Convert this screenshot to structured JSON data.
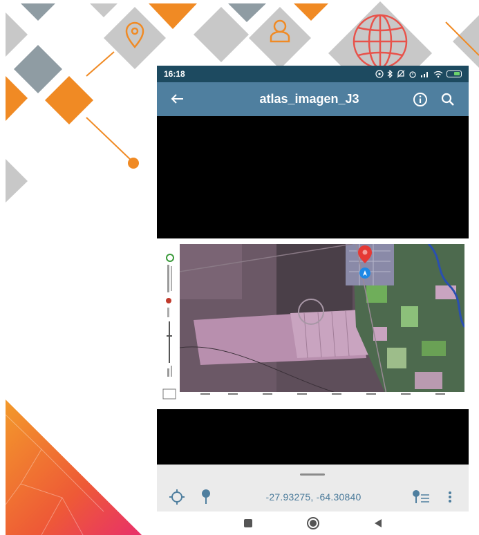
{
  "status_bar": {
    "time": "16:18"
  },
  "app_bar": {
    "title": "atlas_imagen_J3",
    "back_icon": "arrow-left-icon",
    "info_icon": "info-icon",
    "search_icon": "search-icon"
  },
  "bottom_bar": {
    "coordinates": "-27.93275, -64.30840",
    "gps_icon": "crosshair-icon",
    "pin_icon": "map-pin-icon",
    "pin_list_icon": "pin-list-icon",
    "more_icon": "more-vertical-icon"
  },
  "nav_bar": {
    "recents_icon": "square-icon",
    "home_icon": "circle-icon",
    "back_icon": "triangle-back-icon"
  },
  "colors": {
    "status_bar": "#1d4a60",
    "app_bar": "#4f7f9f",
    "accent_orange": "#f08a24",
    "deco_gray": "#8f9ca3",
    "deco_light_gray": "#c8c8c8",
    "pin_red": "#e53935",
    "pin_blue": "#1e88e5",
    "coords_text": "#4a7a9a"
  }
}
